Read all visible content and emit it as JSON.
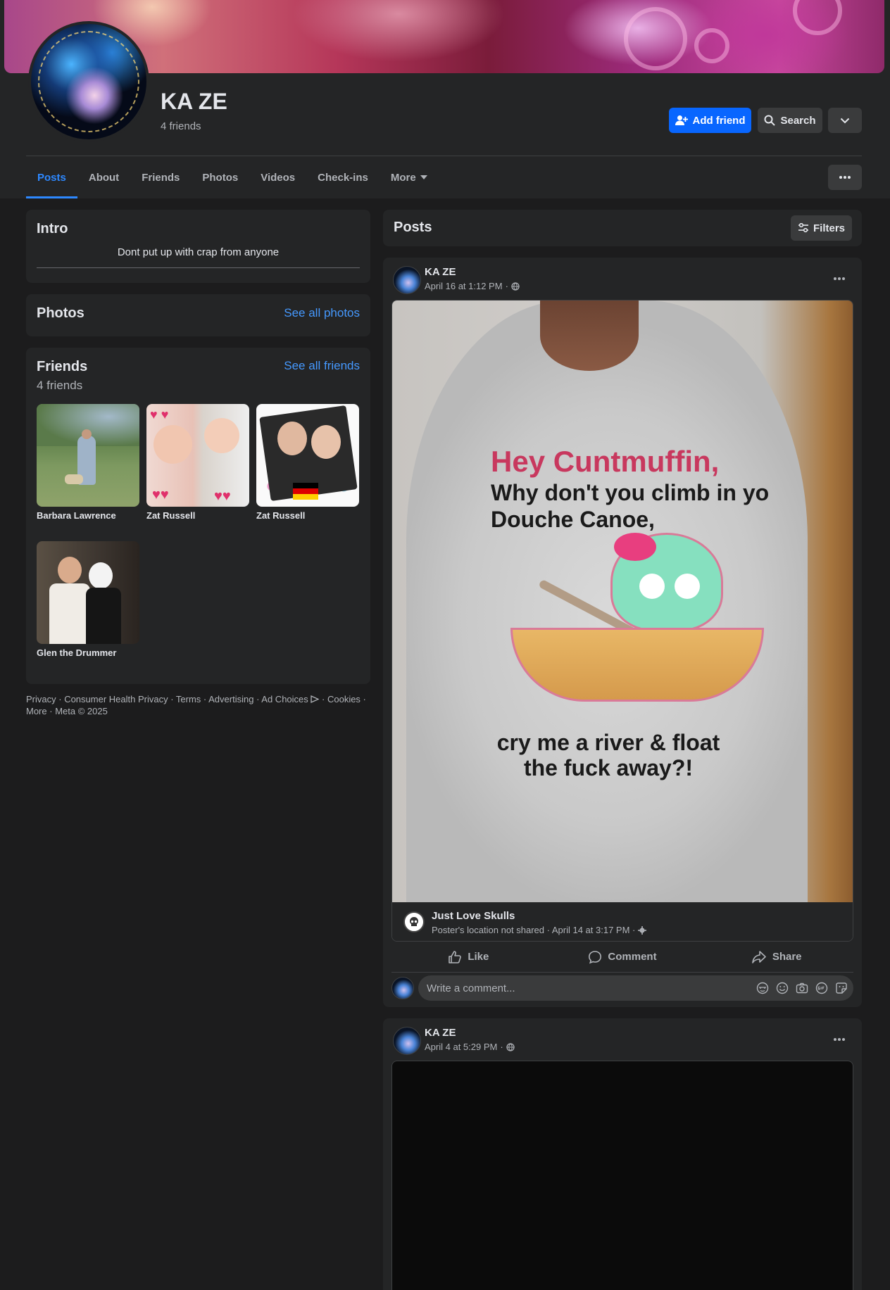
{
  "profile": {
    "name": "KA ZE",
    "friends_count": "4 friends",
    "add_friend_label": "Add friend",
    "search_label": "Search"
  },
  "tabs": [
    {
      "label": "Posts",
      "active": true
    },
    {
      "label": "About"
    },
    {
      "label": "Friends"
    },
    {
      "label": "Photos"
    },
    {
      "label": "Videos"
    },
    {
      "label": "Check-ins"
    },
    {
      "label": "More"
    }
  ],
  "intro": {
    "title": "Intro",
    "bio": "Dont put up with crap from anyone"
  },
  "photos": {
    "title": "Photos",
    "see_all": "See all photos"
  },
  "friends": {
    "title": "Friends",
    "see_all": "See all friends",
    "count": "4 friends",
    "list": [
      {
        "name": "Barbara Lawrence"
      },
      {
        "name": "Zat Russell"
      },
      {
        "name": "Zat Russell"
      },
      {
        "name": "Glen the Drummer"
      }
    ]
  },
  "footer": {
    "links": [
      "Privacy",
      "Consumer Health Privacy",
      "Terms",
      "Advertising",
      "Ad Choices",
      "Cookies",
      "More"
    ],
    "copyright": "Meta © 2025"
  },
  "posts_header": {
    "title": "Posts",
    "filters_label": "Filters"
  },
  "posts": [
    {
      "author": "KA ZE",
      "time": "April 16 at 1:12 PM",
      "shirt_lines": [
        "Hey Cuntmuffin,",
        "Why don't you climb in yo",
        "Douche Canoe,",
        "cry me a river & float",
        "the fuck away?!"
      ],
      "shared": {
        "page": "Just Love Skulls",
        "meta": "Poster's location not shared · April 14 at 3:17 PM ·"
      },
      "actions": {
        "like": "Like",
        "comment": "Comment",
        "share": "Share"
      },
      "comment_placeholder": "Write a comment..."
    },
    {
      "author": "KA ZE",
      "time": "April 4 at 5:29 PM"
    }
  ],
  "colors": {
    "accent": "#0866ff",
    "link": "#4599ff",
    "card": "#242526",
    "page_bg": "#1c1c1d"
  }
}
